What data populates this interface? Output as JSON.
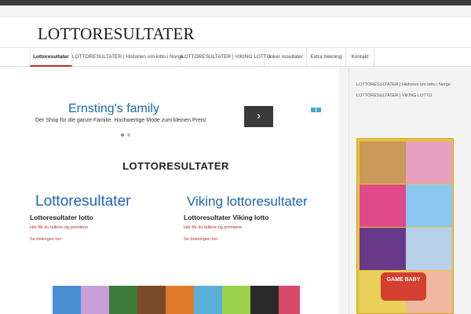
{
  "site": {
    "logo": "LOTTORESULTATER"
  },
  "nav": [
    {
      "label": "Lottoresultater",
      "active": true
    },
    {
      "label": "LOTTORESULTATER | Historien om lotto i Norge",
      "active": false
    },
    {
      "label": "LOTTORESULTATER | VIKING LOTTO",
      "active": false
    },
    {
      "label": "Joker resultater",
      "active": false
    },
    {
      "label": "Extra trekning",
      "active": false
    },
    {
      "label": "Kontakt",
      "active": false
    }
  ],
  "ad": {
    "title": "Ernsting's family",
    "text": "Der Shop für die ganze Familie. Hochwertige Mode zum kleinen Preis!",
    "arrow": "›",
    "choices_color": "#4aa8cf"
  },
  "main": {
    "title": "LOTTORESULTATER",
    "columns": [
      {
        "logo": "Lottoresultater",
        "heading": "Lottoresultater lotto",
        "link1": "Her får du tallene og premiene",
        "link2": "Se trekingen her"
      },
      {
        "logo": "Viking lottoresultater",
        "heading": "Lottoresultater Viking lotto",
        "link1": "Her får du tallene og premiene",
        "link2": "Se trekningen her"
      }
    ]
  },
  "sidebar": {
    "links": [
      "LOTTORESULTATER | Historien om lotto i Norge",
      "LOTTORESULTATER | VIKING LOTTO"
    ],
    "ad_badge": "GAME BABY"
  },
  "colors": {
    "accent": "#b5312b",
    "logo_blue": "#1b63b6",
    "ad_blue": "#1a69a6"
  }
}
